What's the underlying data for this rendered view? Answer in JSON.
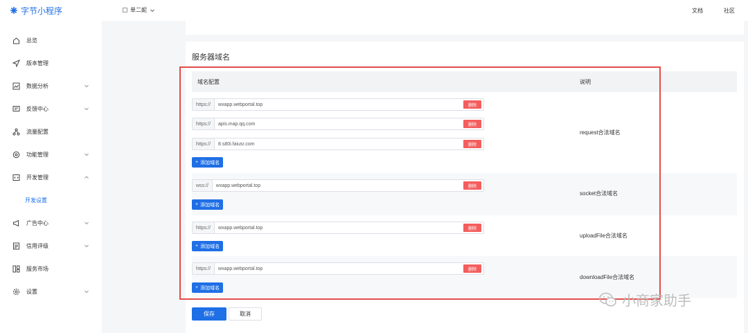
{
  "sidebar": {
    "logo": "字节小程序",
    "items": [
      {
        "label": "总览",
        "icon": "home-icon",
        "chevron": ""
      },
      {
        "label": "版本管理",
        "icon": "send-icon",
        "chevron": ""
      },
      {
        "label": "数据分析",
        "icon": "chart-icon",
        "chevron": "down"
      },
      {
        "label": "反馈中心",
        "icon": "message-icon",
        "chevron": "down"
      },
      {
        "label": "流量配置",
        "icon": "share-icon",
        "chevron": ""
      },
      {
        "label": "功能管理",
        "icon": "settings-icon",
        "chevron": "down"
      },
      {
        "label": "开发管理",
        "icon": "code-icon",
        "chevron": "up"
      }
    ],
    "sub_item": "开发设置",
    "items2": [
      {
        "label": "广告中心",
        "icon": "megaphone-icon",
        "chevron": "down"
      },
      {
        "label": "信用评级",
        "icon": "doc-icon",
        "chevron": "down"
      },
      {
        "label": "服务市场",
        "icon": "market-icon",
        "chevron": ""
      },
      {
        "label": "设置",
        "icon": "gear-icon",
        "chevron": "down"
      }
    ]
  },
  "topbar": {
    "app_name": "单二妮",
    "docs": "文档",
    "community": "社区"
  },
  "main": {
    "section_title": "服务器域名",
    "col1": "域名配置",
    "col2": "说明",
    "delete_label": "删除",
    "add_label": "添加域名",
    "groups": [
      {
        "desc": "request合法域名",
        "rows": [
          {
            "prefix": "https://",
            "value": "wxapp.webportal.top"
          },
          {
            "prefix": "https://",
            "value": "apis.map.qq.com"
          },
          {
            "prefix": "https://",
            "value": "8.s80i.faiusr.com"
          }
        ]
      },
      {
        "desc": "socket合法域名",
        "rows": [
          {
            "prefix": "wss://",
            "value": "wxapp.webportal.top"
          }
        ]
      },
      {
        "desc": "uploadFile合法域名",
        "rows": [
          {
            "prefix": "https://",
            "value": "wxapp.webportal.top"
          }
        ]
      },
      {
        "desc": "downloadFile合法域名",
        "rows": [
          {
            "prefix": "https://",
            "value": "wxapp.webportal.top"
          }
        ]
      }
    ],
    "save": "保存",
    "cancel": "取消"
  },
  "watermark": "小商家助手",
  "colors": {
    "accent": "#1f6fe6",
    "danger": "#f45d5d",
    "highlight": "#e24b4b"
  }
}
